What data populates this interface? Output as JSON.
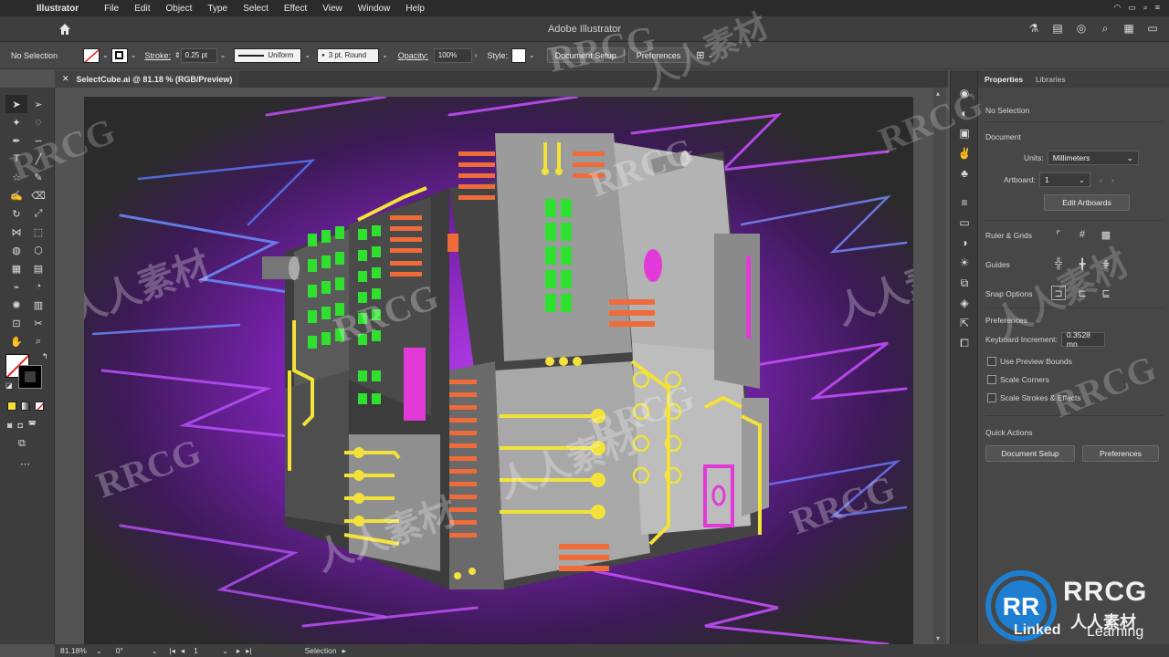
{
  "menubar": {
    "app": "Illustrator",
    "items": [
      "File",
      "Edit",
      "Object",
      "Type",
      "Select",
      "Effect",
      "View",
      "Window",
      "Help"
    ]
  },
  "appbar": {
    "title": "Adobe Illustrator"
  },
  "control": {
    "selection": "No Selection",
    "stroke_label": "Stroke:",
    "stroke_value": "0.25 pt",
    "profile": "Uniform",
    "brush": "3 pt. Round",
    "opacity_label": "Opacity:",
    "opacity_value": "100%",
    "style_label": "Style:",
    "document_setup": "Document Setup",
    "preferences": "Preferences"
  },
  "document": {
    "tab": "SelectCube.ai @ 81.18 % (RGB/Preview)"
  },
  "properties": {
    "tab_properties": "Properties",
    "tab_libraries": "Libraries",
    "no_selection": "No Selection",
    "document_heading": "Document",
    "units_label": "Units:",
    "units_value": "Millimeters",
    "artboard_label": "Artboard:",
    "artboard_value": "1",
    "edit_artboards": "Edit Artboards",
    "ruler_grids": "Ruler & Grids",
    "guides": "Guides",
    "snap_options": "Snap Options",
    "preferences_heading": "Preferences",
    "keyboard_increment_label": "Keyboard Increment:",
    "keyboard_increment_value": "0.3528 mn",
    "use_preview_bounds": "Use Preview Bounds",
    "scale_corners": "Scale Corners",
    "scale_strokes": "Scale Strokes & Effects",
    "quick_actions": "Quick Actions",
    "qa_document_setup": "Document Setup",
    "qa_preferences": "Preferences"
  },
  "status": {
    "zoom": "81.18%",
    "rotation": "0°",
    "artboard": "1",
    "mode": "Selection"
  },
  "watermark": {
    "brand": "RRCG",
    "sub": "人人素材",
    "linked": "Linked",
    "learning": "Learning"
  },
  "colors": {
    "accent_purple": "#9b2fd0",
    "neon_green": "#2fe02f",
    "neon_yellow": "#f2e23a",
    "neon_orange": "#f06b3a",
    "neon_pink": "#e23ad8"
  }
}
